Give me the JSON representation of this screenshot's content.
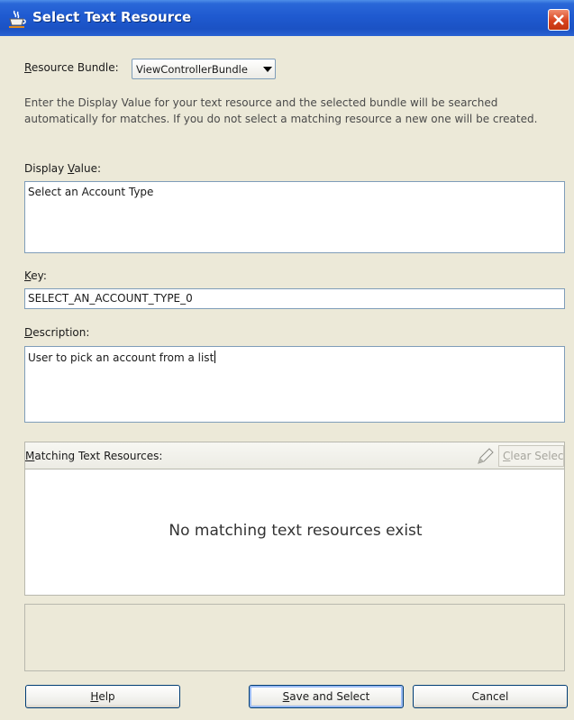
{
  "window": {
    "title": "Select Text Resource"
  },
  "resource_bundle": {
    "label": "Resource Bundle:",
    "value": "ViewControllerBundle"
  },
  "instructions": "Enter the Display Value for your text resource and the selected bundle will be searched automatically for matches.  If you do not select a matching resource a new one will be created.",
  "display_value": {
    "label": "Display Value:",
    "value": "Select an Account Type"
  },
  "key": {
    "label": "Key:",
    "value": "SELECT_AN_ACCOUNT_TYPE_0"
  },
  "description": {
    "label": "Description:",
    "value": "User to pick an account from a list"
  },
  "matching": {
    "label": "Matching Text Resources:",
    "clear_label": "Clear Selection",
    "empty_message": "No matching text resources exist"
  },
  "buttons": {
    "help": "Help",
    "save": "Save and Select",
    "cancel": "Cancel"
  },
  "colors": {
    "titlebar": "#1f5ad0",
    "dialog_bg": "#ece9d8",
    "field_border": "#7f9db9",
    "close_button": "#d8431e"
  }
}
